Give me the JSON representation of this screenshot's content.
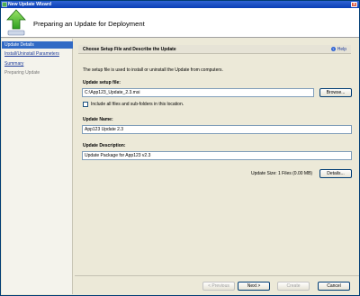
{
  "window": {
    "title": "New Update Wizard",
    "close_glyph": "x"
  },
  "header": {
    "title": "Preparing an Update for Deployment"
  },
  "sidebar": {
    "items": [
      {
        "label": "Update Details",
        "state": "selected"
      },
      {
        "label": "Install/Uninstall Parameters",
        "state": "link"
      },
      {
        "label": "Summary",
        "state": "link"
      },
      {
        "label": "Preparing Update",
        "state": "disabled"
      }
    ]
  },
  "section": {
    "title": "Choose Setup File and Describe the Update",
    "help_label": "Help"
  },
  "form": {
    "description": "The setup file is used to install or uninstall the Update from computers.",
    "setup_file_label": "Update setup file:",
    "setup_file_value": "C:\\App123_Update_2.3.msi",
    "browse_label": "Browse...",
    "include_all_label": "Include all files and sub-folders in this location.",
    "include_all_checked": false,
    "name_label": "Update Name:",
    "name_value": "App123 Update 2.3",
    "description_label": "Update Description:",
    "description_value": "Update Package for App123 v2.3",
    "size_text": "Update Size: 1 Files (0.00 MB)",
    "details_label": "Details..."
  },
  "footer": {
    "previous_label": "< Previous",
    "next_label": "Next >",
    "create_label": "Create",
    "cancel_label": "Cancel"
  },
  "colors": {
    "accent": "#316ac5",
    "titlebar": "#0a3fb5",
    "link": "#1f3d9c"
  },
  "icons": [
    "install-arrow-icon",
    "help-icon",
    "wizard-icon",
    "close-icon"
  ]
}
